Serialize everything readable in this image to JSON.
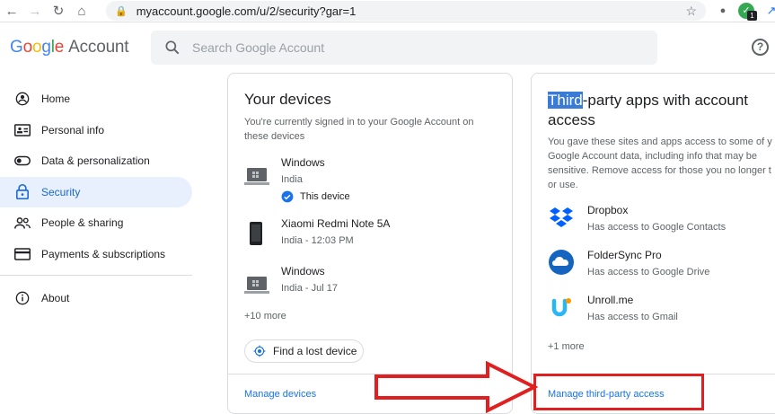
{
  "browser": {
    "url": "myaccount.google.com/u/2/security?gar=1",
    "ext_badge": "1"
  },
  "header": {
    "logo_letters": [
      "G",
      "o",
      "o",
      "g",
      "l",
      "e"
    ],
    "logo_suffix": "Account",
    "search_placeholder": "Search Google Account",
    "help_glyph": "?"
  },
  "sidebar": {
    "items": [
      {
        "label": "Home",
        "icon": "home-icon"
      },
      {
        "label": "Personal info",
        "icon": "id-card-icon"
      },
      {
        "label": "Data & personalization",
        "icon": "toggle-icon"
      },
      {
        "label": "Security",
        "icon": "lock-icon",
        "active": true
      },
      {
        "label": "People & sharing",
        "icon": "people-icon"
      },
      {
        "label": "Payments & subscriptions",
        "icon": "card-icon"
      },
      {
        "label": "About",
        "icon": "info-icon"
      }
    ]
  },
  "devices_card": {
    "title": "Your devices",
    "description": "You're currently signed in to your Google Account on these devices",
    "devices": [
      {
        "name": "Windows",
        "detail": "India",
        "this_device": "This device"
      },
      {
        "name": "Xiaomi Redmi Note 5A",
        "detail": "India - 12:03 PM"
      },
      {
        "name": "Windows",
        "detail": "India - Jul 17"
      }
    ],
    "more": "+10 more",
    "find_device": "Find a lost device",
    "manage": "Manage devices"
  },
  "apps_card": {
    "title_highlight": "Third",
    "title_rest_line1": "-party apps with account",
    "title_line2": "access",
    "description_lines": [
      "You gave these sites and apps access to some of y",
      "Google Account data, including info that may be",
      "sensitive. Remove access for those you no longer t",
      "or use."
    ],
    "apps": [
      {
        "name": "Dropbox",
        "access": "Has access to Google Contacts"
      },
      {
        "name": "FolderSync Pro",
        "access": "Has access to Google Drive"
      },
      {
        "name": "Unroll.me",
        "access": "Has access to Gmail"
      }
    ],
    "more": "+1 more",
    "manage": "Manage third-party access"
  },
  "colors": {
    "accent": "#1a73e8",
    "annotation": "#e02020"
  }
}
